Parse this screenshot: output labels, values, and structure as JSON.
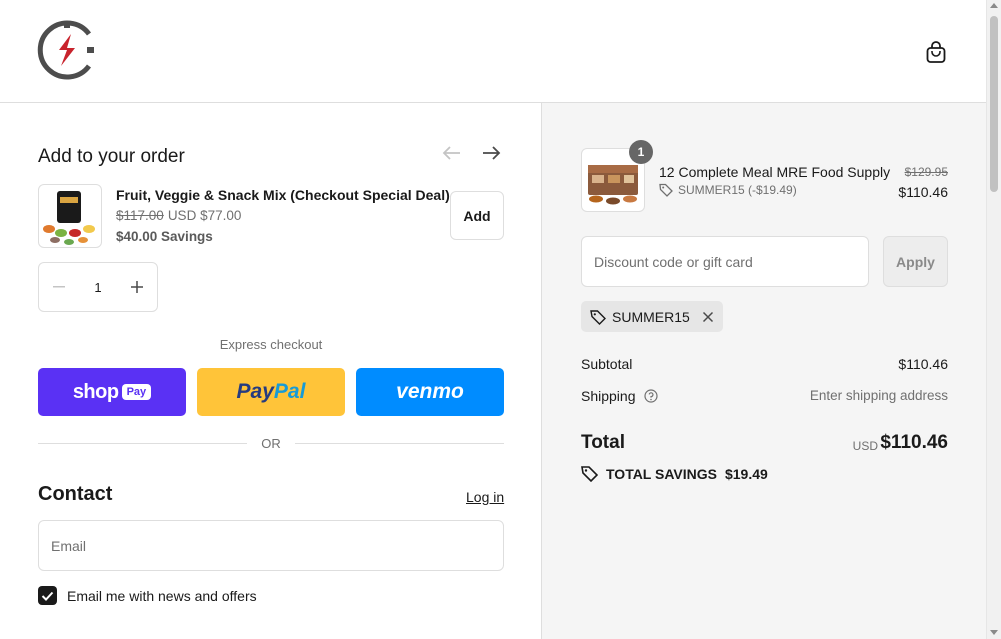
{
  "colors": {
    "shop_pay": "#5a31f4",
    "paypal": "#ffc439",
    "venmo": "#008cff",
    "logo_red": "#c8232c",
    "logo_gray": "#4d4d4d"
  },
  "header": {
    "logo_icon": "brand-logo-icon",
    "cart_icon": "shopping-bag-icon"
  },
  "upsell": {
    "title": "Add to your order",
    "product_name": "Fruit, Veggie & Snack Mix (Checkout Special Deal)",
    "compare_price": "$117.00",
    "price": "USD $77.00",
    "savings": "$40.00 Savings",
    "add_label": "Add",
    "quantity": "1"
  },
  "express": {
    "label": "Express checkout",
    "shop_label": "shop",
    "shop_pay_label": "Pay",
    "paypal_label_a": "Pay",
    "paypal_label_b": "Pal",
    "venmo_label": "venmo",
    "or_label": "OR"
  },
  "contact": {
    "title": "Contact",
    "login_label": "Log in",
    "email_placeholder": "Email",
    "newsletter_label": "Email me with news and offers",
    "newsletter_checked": true
  },
  "summary": {
    "line_item": {
      "quantity": "1",
      "name": "12 Complete Meal MRE Food Supply",
      "discount": "SUMMER15 (-$19.49)",
      "compare_price": "$129.95",
      "price": "$110.46"
    },
    "discount_placeholder": "Discount code or gift card",
    "apply_label": "Apply",
    "applied_code": "SUMMER15",
    "subtotal_label": "Subtotal",
    "subtotal_value": "$110.46",
    "shipping_label": "Shipping",
    "shipping_value": "Enter shipping address",
    "total_label": "Total",
    "currency": "USD",
    "total_value": "$110.46",
    "savings_label": "TOTAL SAVINGS",
    "savings_value": "$19.49"
  }
}
